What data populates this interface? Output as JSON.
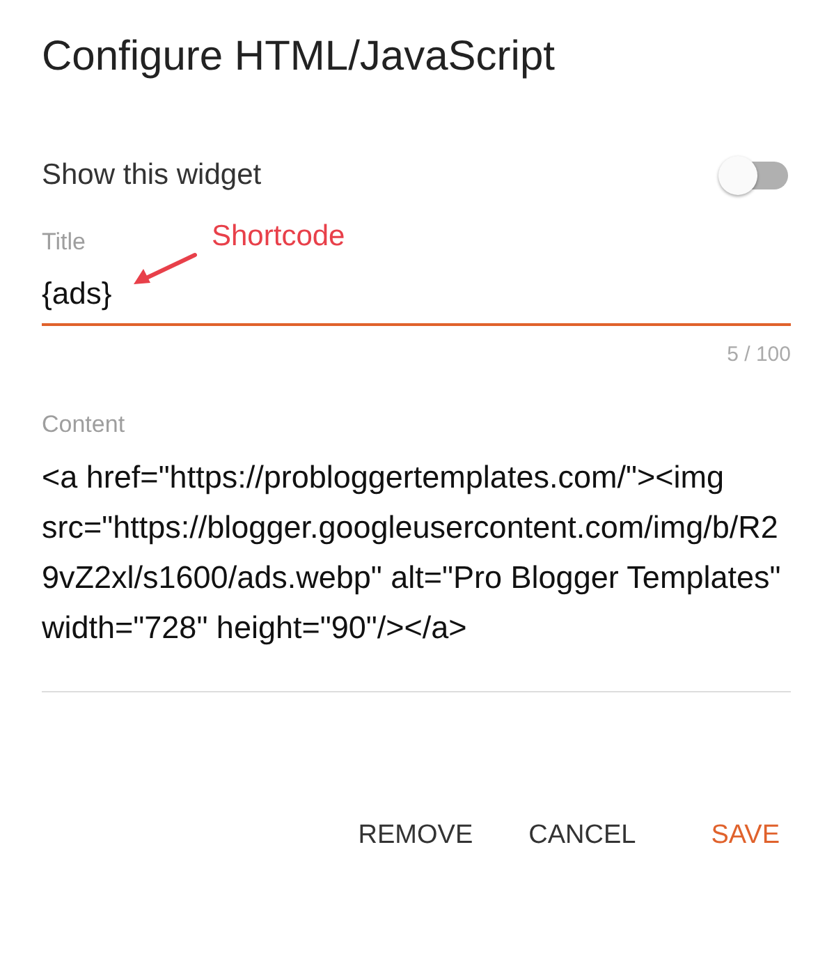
{
  "dialog": {
    "title": "Configure HTML/JavaScript"
  },
  "show_widget": {
    "label": "Show this widget",
    "on": false
  },
  "title_field": {
    "label": "Title",
    "value": "{ads}",
    "counter": "5 / 100",
    "focused": true
  },
  "annotation": {
    "text": "Shortcode"
  },
  "content_field": {
    "label": "Content",
    "value": "<a href=\"https://probloggertemplates.com/\"><img src=\"https://blogger.googleusercontent.com/img/b/R29vZ2xl/s1600/ads.webp\" alt=\"Pro Blogger Templates\" width=\"728\" height=\"90\"/></a>"
  },
  "buttons": [
    {
      "label": "REMOVE",
      "kind": "text"
    },
    {
      "label": "CANCEL",
      "kind": "text"
    },
    {
      "label": "SAVE",
      "kind": "primary"
    }
  ]
}
